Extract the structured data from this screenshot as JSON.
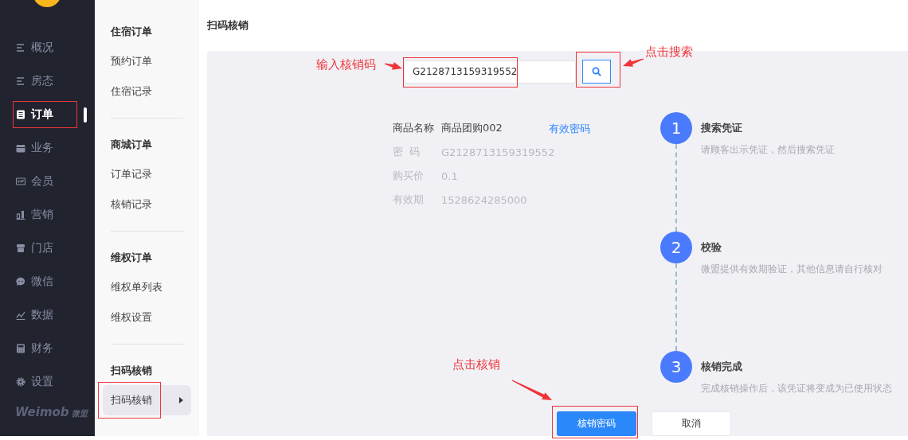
{
  "sidebar": {
    "items": [
      {
        "label": "概况",
        "selected": false,
        "annotated": false
      },
      {
        "label": "房态",
        "selected": false,
        "annotated": false
      },
      {
        "label": "订单",
        "selected": true,
        "annotated": true
      },
      {
        "label": "业务",
        "selected": false,
        "annotated": false
      },
      {
        "label": "会员",
        "selected": false,
        "annotated": false
      },
      {
        "label": "营销",
        "selected": false,
        "annotated": false
      },
      {
        "label": "门店",
        "selected": false,
        "annotated": false
      },
      {
        "label": "微信",
        "selected": false,
        "annotated": false
      },
      {
        "label": "数据",
        "selected": false,
        "annotated": false
      },
      {
        "label": "财务",
        "selected": false,
        "annotated": false
      },
      {
        "label": "设置",
        "selected": false,
        "annotated": false
      }
    ],
    "brand": "Weimob",
    "brand_cn": "微盟"
  },
  "submenu": {
    "groups": [
      {
        "title": "住宿订单",
        "items": [
          {
            "label": "预约订单",
            "selected": false,
            "annotated": false
          },
          {
            "label": "住宿记录",
            "selected": false,
            "annotated": false
          }
        ]
      },
      {
        "title": "商城订单",
        "items": [
          {
            "label": "订单记录",
            "selected": false,
            "annotated": false
          },
          {
            "label": "核销记录",
            "selected": false,
            "annotated": false
          }
        ]
      },
      {
        "title": "维权订单",
        "items": [
          {
            "label": "维权单列表",
            "selected": false,
            "annotated": false
          },
          {
            "label": "维权设置",
            "selected": false,
            "annotated": false
          }
        ]
      },
      {
        "title": "扫码核销",
        "items": [
          {
            "label": "扫码核销",
            "selected": true,
            "annotated": true
          }
        ]
      }
    ]
  },
  "page_title": "扫码核销",
  "search": {
    "value": "G2128713159319552",
    "annotated": true,
    "button_annotated": true
  },
  "info": {
    "rows": [
      {
        "label": "商品名称",
        "value": "商品团购002",
        "emphasis": true
      },
      {
        "label": "密  码",
        "value": "G2128713159319552",
        "emphasis": false
      },
      {
        "label": "购买价",
        "value": "0.1",
        "emphasis": false
      },
      {
        "label": "有效期",
        "value": "1528624285000",
        "emphasis": false
      }
    ],
    "status": "有效密码"
  },
  "steps": [
    {
      "number": "1",
      "title": "搜索凭证",
      "description": "请顾客出示凭证，然后搜索凭证"
    },
    {
      "number": "2",
      "title": "校验",
      "description": "微盟提供有效期验证，其他信息请自行核对"
    },
    {
      "number": "3",
      "title": "核销完成",
      "description": "完成核销操作后，该凭证将变成为已使用状态"
    }
  ],
  "buttons": [
    {
      "label": "核销密码",
      "kind": "primary",
      "annotated": true
    },
    {
      "label": "取消",
      "kind": "default"
    }
  ],
  "callouts": [
    "输入核销码",
    "点击搜索",
    "点击核销"
  ]
}
